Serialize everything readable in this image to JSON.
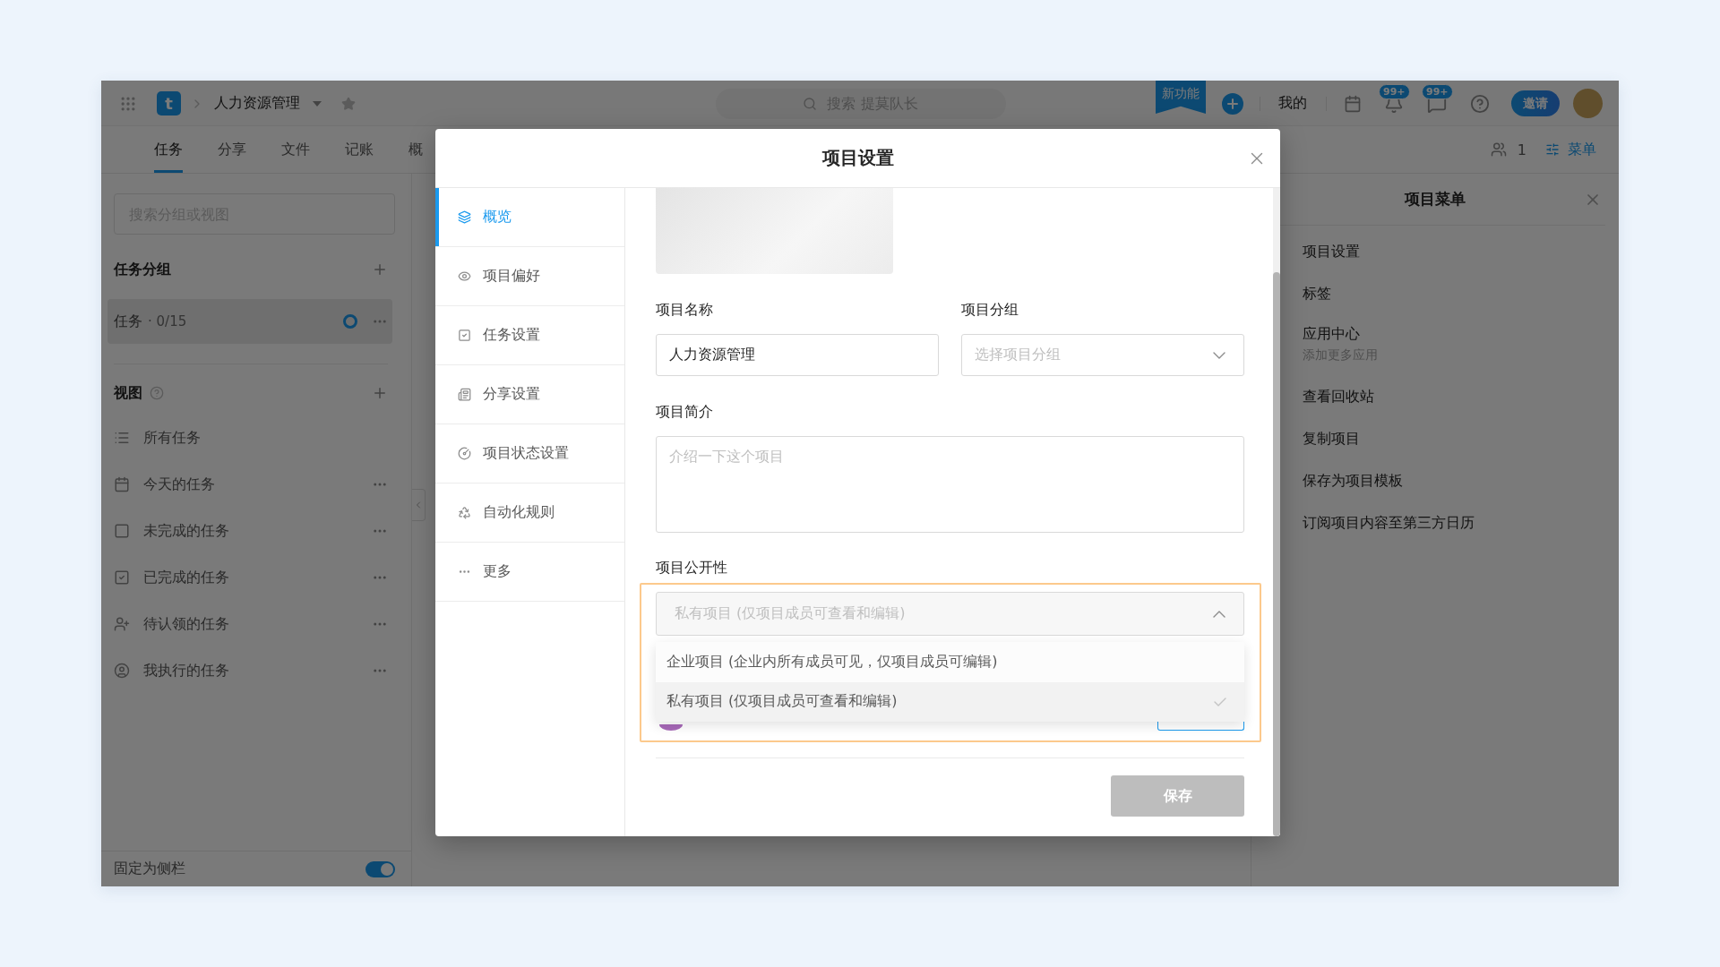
{
  "top_bar": {
    "logo": "t",
    "project_name": "人力资源管理",
    "search_placeholder": "搜索 提莫队长",
    "new_feature": "新功能",
    "my_link": "我的",
    "notifications_badge": "99+",
    "messages_badge": "99+",
    "invite_button": "邀请"
  },
  "tabs": [
    {
      "label": "任务",
      "selected": true
    },
    {
      "label": "分享",
      "selected": false
    },
    {
      "label": "文件",
      "selected": false
    },
    {
      "label": "记账",
      "selected": false
    },
    {
      "label": "概",
      "selected": false
    }
  ],
  "tab_bar_right": {
    "member_count": "1",
    "menu_button": "菜单"
  },
  "sidebar": {
    "search_placeholder": "搜索分组或视图",
    "groups_title": "任务分组",
    "groups": [
      {
        "label": "任务",
        "count": "· 0/15",
        "selected": true
      }
    ],
    "views_title": "视图",
    "views": [
      {
        "label": "所有任务",
        "more": false
      },
      {
        "label": "今天的任务",
        "more": true
      },
      {
        "label": "未完成的任务",
        "more": true
      },
      {
        "label": "已完成的任务",
        "more": true
      },
      {
        "label": "待认领的任务",
        "more": true
      },
      {
        "label": "我执行的任务",
        "more": true
      }
    ],
    "pin_label": "固定为侧栏",
    "pin_on": true
  },
  "project_menu": {
    "title": "项目菜单",
    "items": [
      {
        "label": "项目设置"
      },
      {
        "label": "标签"
      },
      {
        "label": "应用中心",
        "subtitle": "添加更多应用"
      },
      {
        "label": "查看回收站"
      },
      {
        "label": "复制项目"
      },
      {
        "label": "保存为项目模板"
      },
      {
        "label": "订阅项目内容至第三方日历"
      }
    ]
  },
  "dialog": {
    "title": "项目设置",
    "nav": [
      {
        "label": "概览",
        "selected": true
      },
      {
        "label": "项目偏好",
        "selected": false
      },
      {
        "label": "任务设置",
        "selected": false
      },
      {
        "label": "分享设置",
        "selected": false
      },
      {
        "label": "项目状态设置",
        "selected": false
      },
      {
        "label": "自动化规则",
        "selected": false
      },
      {
        "label": "更多",
        "selected": false
      }
    ],
    "form": {
      "name_label": "项目名称",
      "name_value": "人力资源管理",
      "group_label": "项目分组",
      "group_placeholder": "选择项目分组",
      "description_label": "项目简介",
      "description_placeholder": "介绍一下这个项目",
      "visibility_label": "项目公开性",
      "visibility": {
        "value": "私有项目 (仅项目成员可查看和编辑)",
        "expanded": true,
        "highlighted": true,
        "options": [
          {
            "label": "企业项目 (企业内所有成员可见，仅项目成员可编辑)",
            "selected": false
          },
          {
            "label": "私有项目 (仅项目成员可查看和编辑)",
            "selected": true
          }
        ]
      },
      "save_button": {
        "label": "保存",
        "disabled": true
      }
    }
  }
}
